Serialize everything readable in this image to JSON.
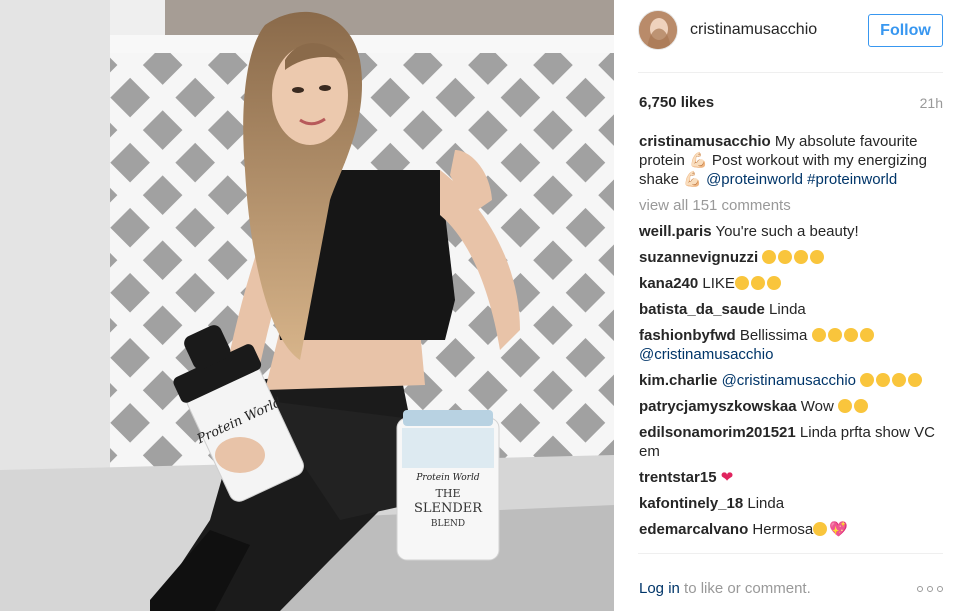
{
  "post": {
    "username": "cristinamusacchio",
    "follow_label": "Follow",
    "likes": "6,750 likes",
    "time": "21h",
    "caption": {
      "user": "cristinamusacchio",
      "text1": " My absolute favourite protein ",
      "text2": " Post workout with my energizing shake ",
      "mention": "@proteinworld",
      "hashtag": "#proteinworld"
    },
    "view_all": "view all 151 comments",
    "comments": [
      {
        "user": "weill.paris",
        "text": " You're such a beauty!"
      },
      {
        "user": "suzannevignuzzi",
        "text": " "
      },
      {
        "user": "kana240",
        "text": " LIKE"
      },
      {
        "user": "batista_da_saude",
        "text": " Linda"
      },
      {
        "user": "fashionbyfwd",
        "text": " Bellissima ",
        "mention": "@cristinamusacchio"
      },
      {
        "user": "kim.charlie",
        "text": " ",
        "mention": "@cristinamusacchio"
      },
      {
        "user": "patrycjamyszkowskaa",
        "text": " Wow "
      },
      {
        "user": "edilsonamorim201521",
        "text": " Linda prfta show VC em"
      },
      {
        "user": "trentstar15",
        "text": " "
      },
      {
        "user": "kafontinely_18",
        "text": " Linda"
      },
      {
        "user": "edemarcalvano",
        "text": " Hermosa"
      }
    ],
    "login_link": "Log in",
    "login_rest": " to like or comment."
  },
  "photo": {
    "product_brand": "Protein World",
    "product_name_1": "THE",
    "product_name_2": "SLENDER",
    "product_name_3": "BLEND"
  },
  "colors": {
    "link": "#003569",
    "follow": "#3897f0",
    "muted": "#999999"
  }
}
